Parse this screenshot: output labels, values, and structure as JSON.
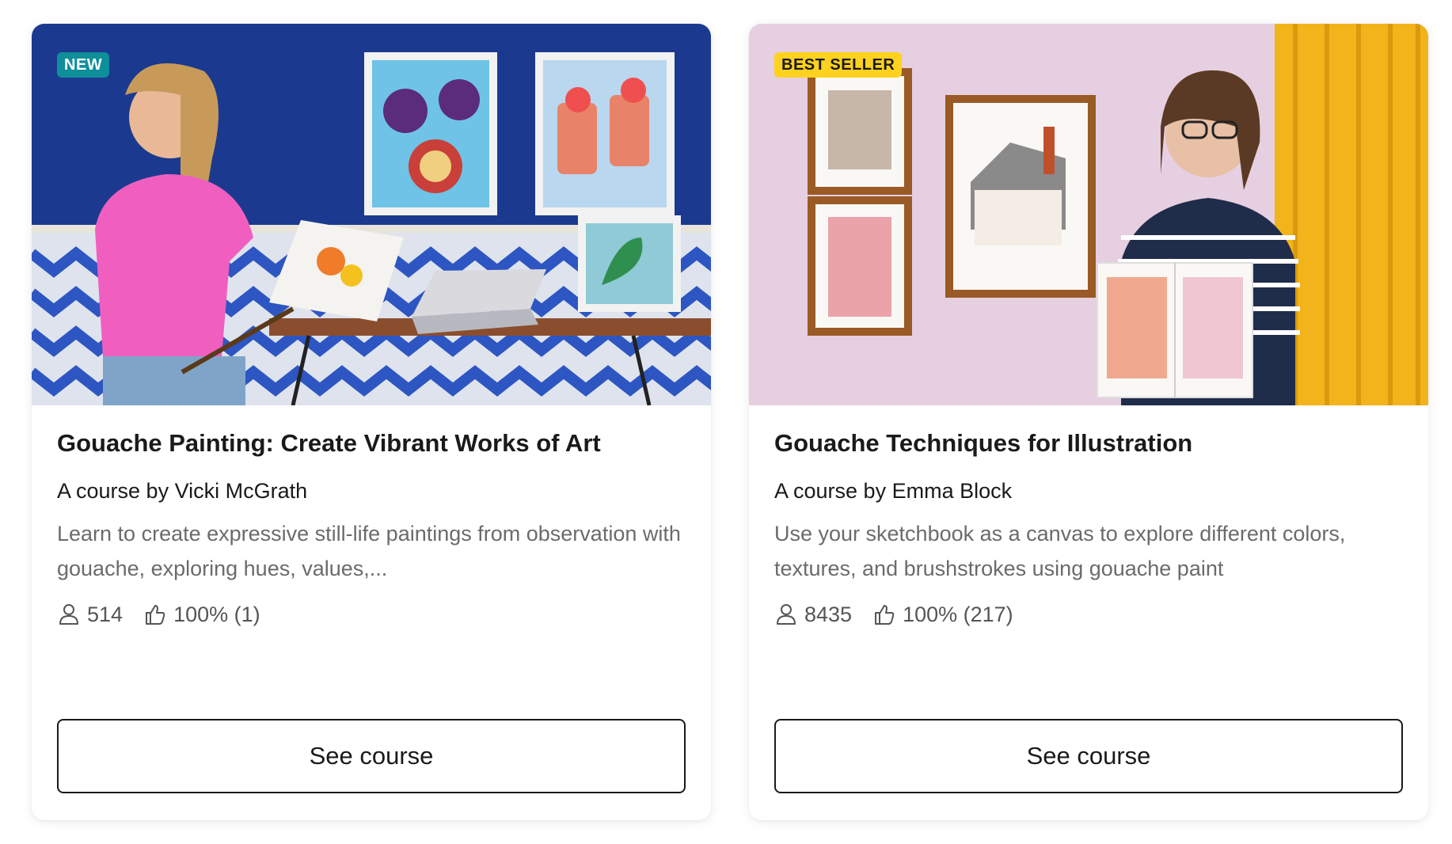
{
  "cards": [
    {
      "badge": "NEW",
      "title": "Gouache Painting: Create Vibrant Works of Art",
      "author": "A course by Vicki McGrath",
      "description": "Learn to create expressive still-life paintings from observation with gouache, exploring hues, values,...",
      "students": "514",
      "rating": "100% (1)",
      "button_label": "See course"
    },
    {
      "badge": "BEST SELLER",
      "title": "Gouache Techniques for Illustration",
      "author": "A course by Emma Block",
      "description": "Use your sketchbook as a canvas to explore different colors, textures, and brushstrokes using gouache paint",
      "students": "8435",
      "rating": "100% (217)",
      "button_label": "See course"
    }
  ],
  "colors": {
    "badge_new": "#0e8f9a",
    "badge_best_seller": "#ffd21f",
    "text_primary": "#1a1a1a",
    "text_secondary": "#6b6b6b"
  },
  "icons": {
    "students": "person-icon",
    "rating": "thumbs-up-icon"
  }
}
